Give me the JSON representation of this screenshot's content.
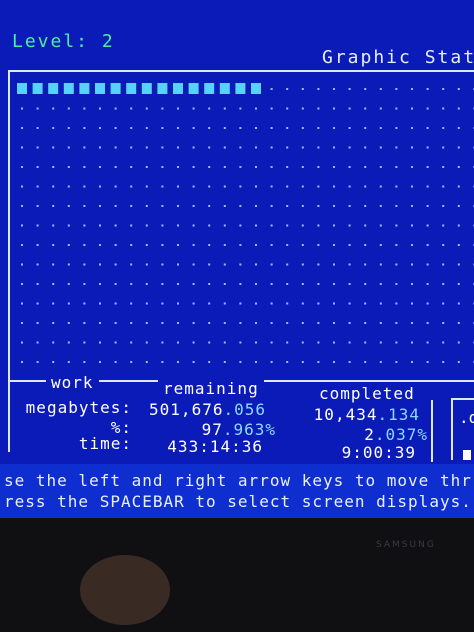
{
  "level": {
    "label": "Level:",
    "value": "2"
  },
  "window_title": "Graphic Statu",
  "progress": {
    "fraction": 0.02037,
    "filled_cells": 16
  },
  "table": {
    "headers": {
      "work": "work",
      "remaining": "remaining",
      "completed": "completed"
    },
    "rows": [
      {
        "label": "megabytes:",
        "remaining_int": "501,676",
        "remaining_frac": ".056",
        "completed_int": "10,434",
        "completed_frac": ".134"
      },
      {
        "label": "%:",
        "remaining_int": "97",
        "remaining_frac": ".963%",
        "completed_int": "2",
        "completed_frac": ".037%"
      },
      {
        "label": "time:",
        "remaining_int": "433:14:36",
        "remaining_frac": "",
        "completed_int": "9:00:39",
        "completed_frac": ""
      }
    ]
  },
  "side_box": {
    "label": ".o"
  },
  "help_text": [
    "se the left and right arrow keys to move thr",
    "ress the SPACEBAR to select screen displays."
  ],
  "monitor_brand": "SAMSUNG",
  "colors": {
    "screen_bg": "#0b1bb8",
    "level_text": "#49f0a0",
    "progress_cell": "#5ad0ff",
    "dot": "#9fb8ff"
  }
}
